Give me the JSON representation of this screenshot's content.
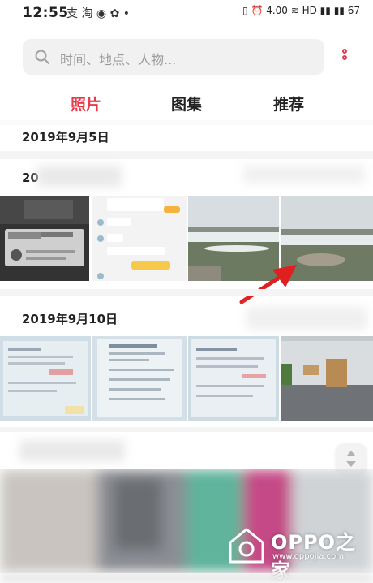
{
  "status_bar": {
    "time": "12:55",
    "apps": "支 淘 ◉ ✿ •",
    "indicators": "▯ ⏰ 4.00 ≋ HD ▮▮ ▮▮ 67"
  },
  "search": {
    "placeholder": "时间、地点、人物..."
  },
  "tabs": [
    {
      "label": "照片",
      "active": true
    },
    {
      "label": "图集",
      "active": false
    },
    {
      "label": "推荐",
      "active": false
    }
  ],
  "sections": [
    {
      "date": "2019年9月5日"
    },
    {
      "date": "2019年9月10日"
    }
  ],
  "partial_date_prefix": "20",
  "watermark": {
    "brand": "OPPO之家",
    "url": "www.oppojia.com"
  },
  "colors": {
    "accent": "#e83a4b",
    "arrow": "#e02020"
  },
  "icons": {
    "search": "search-icon",
    "more": "more-vertical-icon",
    "scroll": "fast-scroll-icon"
  }
}
